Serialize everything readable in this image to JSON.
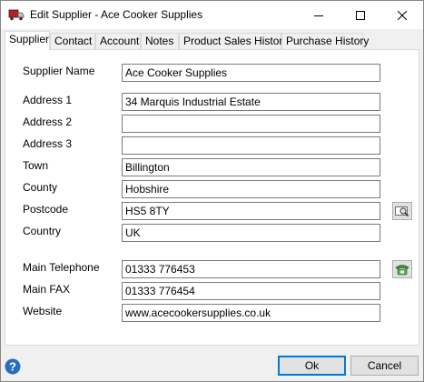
{
  "window": {
    "title": "Edit Supplier - Ace Cooker Supplies",
    "app_icon": "truck-icon"
  },
  "tabs": [
    {
      "label": "Supplier",
      "active": true
    },
    {
      "label": "Contact",
      "active": false
    },
    {
      "label": "Account",
      "active": false
    },
    {
      "label": "Notes",
      "active": false
    },
    {
      "label": "Product Sales History",
      "active": false
    },
    {
      "label": "Purchase History",
      "active": false
    }
  ],
  "form": {
    "supplier_name": {
      "label": "Supplier Name",
      "value": "Ace Cooker Supplies"
    },
    "address1": {
      "label": "Address 1",
      "value": "34 Marquis Industrial Estate"
    },
    "address2": {
      "label": "Address 2",
      "value": ""
    },
    "address3": {
      "label": "Address 3",
      "value": ""
    },
    "town": {
      "label": "Town",
      "value": "Billington"
    },
    "county": {
      "label": "County",
      "value": "Hobshire"
    },
    "postcode": {
      "label": "Postcode",
      "value": "HS5 8TY"
    },
    "country": {
      "label": "Country",
      "value": "UK"
    },
    "main_telephone": {
      "label": "Main Telephone",
      "value": "01333 776453"
    },
    "main_fax": {
      "label": "Main FAX",
      "value": "01333 776454"
    },
    "website": {
      "label": "Website",
      "value": "www.acecookersupplies.co.uk"
    }
  },
  "side_buttons": {
    "postcode_lookup_icon": "map-search-icon",
    "dial_icon": "telephone-icon"
  },
  "buttons": {
    "ok": "Ok",
    "cancel": "Cancel"
  },
  "colors": {
    "accent": "#0078d7",
    "help": "#2a6ebb"
  }
}
